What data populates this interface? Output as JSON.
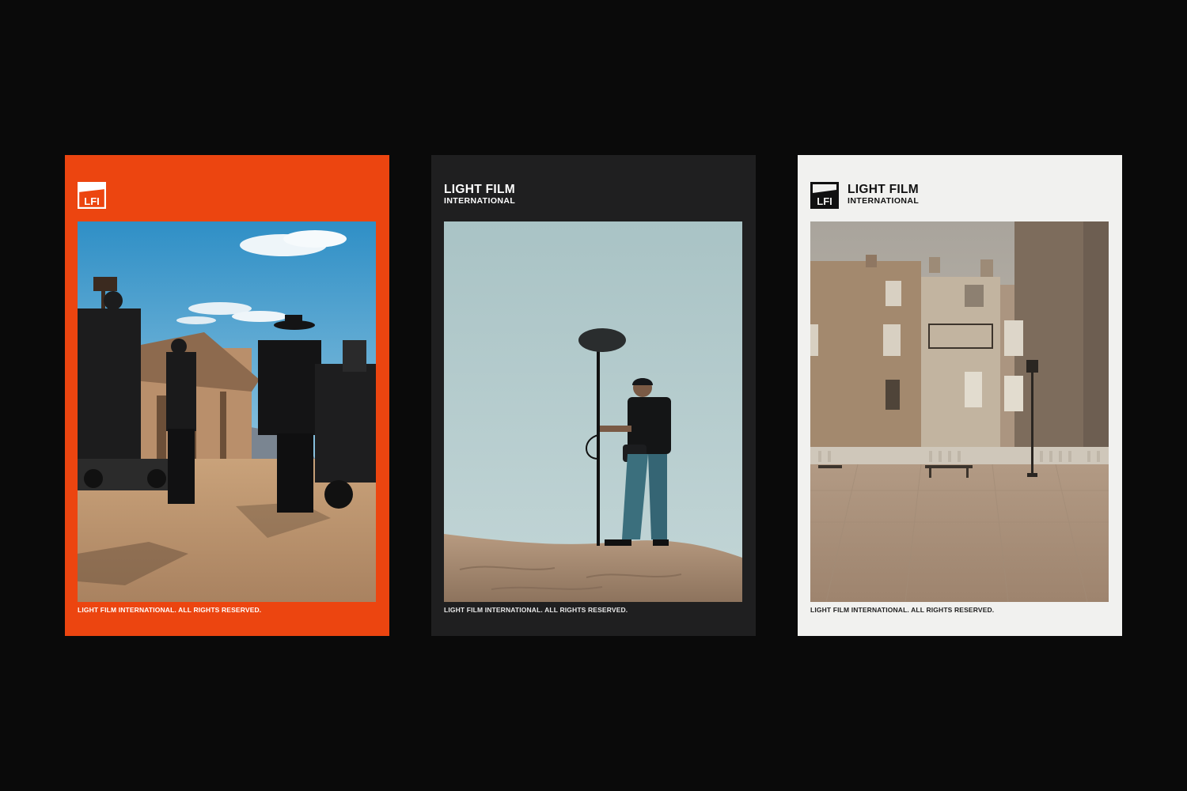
{
  "posters": [
    {
      "id": "orange",
      "background": "#ec4510",
      "logo_text": "LFI",
      "footer": "LIGHT FILM INTERNATIONAL. ALL RIGHTS RESERVED."
    },
    {
      "id": "dark",
      "background": "#1f1f20",
      "wordmark_line1": "LIGHT FILM",
      "wordmark_line2": "INTERNATIONAL",
      "footer": "LIGHT FILM INTERNATIONAL. ALL RIGHTS RESERVED."
    },
    {
      "id": "light",
      "background": "#f1f1ef",
      "logo_text": "LFI",
      "wordmark_line1": "LIGHT FILM",
      "wordmark_line2": "INTERNATIONAL",
      "footer": "LIGHT FILM INTERNATIONAL. ALL RIGHTS RESERVED."
    }
  ],
  "colors": {
    "page_background": "#0a0a0a",
    "accent_orange": "#ec4510"
  }
}
